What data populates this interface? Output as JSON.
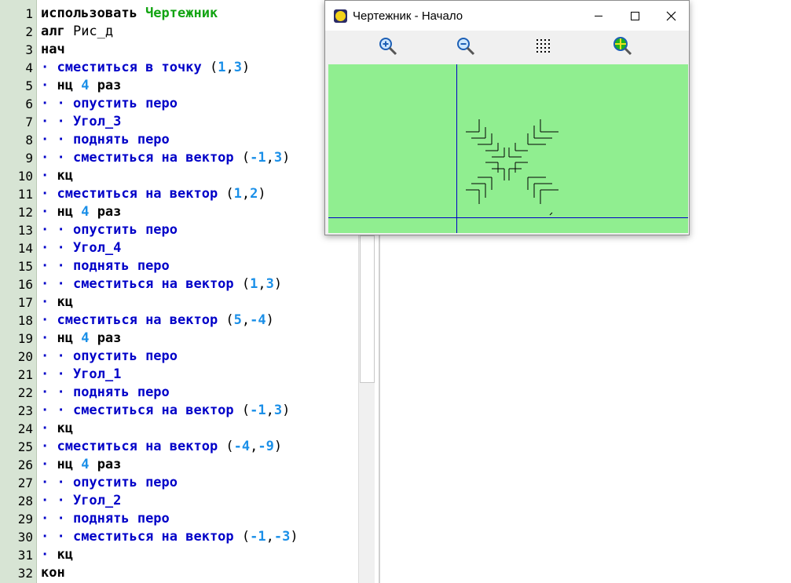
{
  "editor": {
    "lines": [
      {
        "n": "1",
        "parts": [
          {
            "t": "использовать ",
            "c": "kw"
          },
          {
            "t": "Чертежник",
            "c": "grn"
          }
        ]
      },
      {
        "n": "2",
        "parts": [
          {
            "t": "алг ",
            "c": "kw"
          },
          {
            "t": "Рис_д",
            "c": "plain"
          }
        ]
      },
      {
        "n": "3",
        "parts": [
          {
            "t": "нач",
            "c": "kw"
          }
        ]
      },
      {
        "n": "4",
        "parts": [
          {
            "t": "· ",
            "c": "dot"
          },
          {
            "t": "сместиться в точку ",
            "c": "fn"
          },
          {
            "t": "(",
            "c": "plain"
          },
          {
            "t": "1",
            "c": "num"
          },
          {
            "t": ",",
            "c": "plain"
          },
          {
            "t": "3",
            "c": "num"
          },
          {
            "t": ")",
            "c": "plain"
          }
        ]
      },
      {
        "n": "5",
        "parts": [
          {
            "t": "· ",
            "c": "dot"
          },
          {
            "t": "нц ",
            "c": "kw"
          },
          {
            "t": "4",
            "c": "num"
          },
          {
            "t": " раз",
            "c": "kw"
          }
        ]
      },
      {
        "n": "6",
        "parts": [
          {
            "t": "· · ",
            "c": "dot"
          },
          {
            "t": "опустить перо",
            "c": "fn"
          }
        ]
      },
      {
        "n": "7",
        "parts": [
          {
            "t": "· · ",
            "c": "dot"
          },
          {
            "t": "Угол_3",
            "c": "fn"
          }
        ]
      },
      {
        "n": "8",
        "parts": [
          {
            "t": "· · ",
            "c": "dot"
          },
          {
            "t": "поднять перо",
            "c": "fn"
          }
        ]
      },
      {
        "n": "9",
        "parts": [
          {
            "t": "· · ",
            "c": "dot"
          },
          {
            "t": "сместиться на вектор ",
            "c": "fn"
          },
          {
            "t": "(",
            "c": "plain"
          },
          {
            "t": "-1",
            "c": "num"
          },
          {
            "t": ",",
            "c": "plain"
          },
          {
            "t": "3",
            "c": "num"
          },
          {
            "t": ")",
            "c": "plain"
          }
        ]
      },
      {
        "n": "10",
        "parts": [
          {
            "t": "· ",
            "c": "dot"
          },
          {
            "t": "кц",
            "c": "kw"
          }
        ]
      },
      {
        "n": "11",
        "parts": [
          {
            "t": "· ",
            "c": "dot"
          },
          {
            "t": "сместиться на вектор ",
            "c": "fn"
          },
          {
            "t": "(",
            "c": "plain"
          },
          {
            "t": "1",
            "c": "num"
          },
          {
            "t": ",",
            "c": "plain"
          },
          {
            "t": "2",
            "c": "num"
          },
          {
            "t": ")",
            "c": "plain"
          }
        ]
      },
      {
        "n": "12",
        "parts": [
          {
            "t": "· ",
            "c": "dot"
          },
          {
            "t": "нц ",
            "c": "kw"
          },
          {
            "t": "4",
            "c": "num"
          },
          {
            "t": " раз",
            "c": "kw"
          }
        ]
      },
      {
        "n": "13",
        "parts": [
          {
            "t": "· · ",
            "c": "dot"
          },
          {
            "t": "опустить перо",
            "c": "fn"
          }
        ]
      },
      {
        "n": "14",
        "parts": [
          {
            "t": "· · ",
            "c": "dot"
          },
          {
            "t": "Угол_4",
            "c": "fn"
          }
        ]
      },
      {
        "n": "15",
        "parts": [
          {
            "t": "· · ",
            "c": "dot"
          },
          {
            "t": "поднять перо",
            "c": "fn"
          }
        ]
      },
      {
        "n": "16",
        "parts": [
          {
            "t": "· · ",
            "c": "dot"
          },
          {
            "t": "сместиться на вектор ",
            "c": "fn"
          },
          {
            "t": "(",
            "c": "plain"
          },
          {
            "t": "1",
            "c": "num"
          },
          {
            "t": ",",
            "c": "plain"
          },
          {
            "t": "3",
            "c": "num"
          },
          {
            "t": ")",
            "c": "plain"
          }
        ]
      },
      {
        "n": "17",
        "parts": [
          {
            "t": "· ",
            "c": "dot"
          },
          {
            "t": "кц",
            "c": "kw"
          }
        ]
      },
      {
        "n": "18",
        "parts": [
          {
            "t": "· ",
            "c": "dot"
          },
          {
            "t": "сместиться на вектор ",
            "c": "fn"
          },
          {
            "t": "(",
            "c": "plain"
          },
          {
            "t": "5",
            "c": "num"
          },
          {
            "t": ",",
            "c": "plain"
          },
          {
            "t": "-4",
            "c": "num"
          },
          {
            "t": ")",
            "c": "plain"
          }
        ]
      },
      {
        "n": "19",
        "parts": [
          {
            "t": "· ",
            "c": "dot"
          },
          {
            "t": "нц ",
            "c": "kw"
          },
          {
            "t": "4",
            "c": "num"
          },
          {
            "t": " раз",
            "c": "kw"
          }
        ]
      },
      {
        "n": "20",
        "parts": [
          {
            "t": "· · ",
            "c": "dot"
          },
          {
            "t": "опустить перо",
            "c": "fn"
          }
        ]
      },
      {
        "n": "21",
        "parts": [
          {
            "t": "· · ",
            "c": "dot"
          },
          {
            "t": "Угол_1",
            "c": "fn"
          }
        ]
      },
      {
        "n": "22",
        "parts": [
          {
            "t": "· · ",
            "c": "dot"
          },
          {
            "t": "поднять перо",
            "c": "fn"
          }
        ]
      },
      {
        "n": "23",
        "parts": [
          {
            "t": "· · ",
            "c": "dot"
          },
          {
            "t": "сместиться на вектор ",
            "c": "fn"
          },
          {
            "t": "(",
            "c": "plain"
          },
          {
            "t": "-1",
            "c": "num"
          },
          {
            "t": ",",
            "c": "plain"
          },
          {
            "t": "3",
            "c": "num"
          },
          {
            "t": ")",
            "c": "plain"
          }
        ]
      },
      {
        "n": "24",
        "parts": [
          {
            "t": "· ",
            "c": "dot"
          },
          {
            "t": "кц",
            "c": "kw"
          }
        ]
      },
      {
        "n": "25",
        "parts": [
          {
            "t": "· ",
            "c": "dot"
          },
          {
            "t": "сместиться на вектор ",
            "c": "fn"
          },
          {
            "t": "(",
            "c": "plain"
          },
          {
            "t": "-4",
            "c": "num"
          },
          {
            "t": ",",
            "c": "plain"
          },
          {
            "t": "-9",
            "c": "num"
          },
          {
            "t": ")",
            "c": "plain"
          }
        ]
      },
      {
        "n": "26",
        "parts": [
          {
            "t": "· ",
            "c": "dot"
          },
          {
            "t": "нц ",
            "c": "kw"
          },
          {
            "t": "4",
            "c": "num"
          },
          {
            "t": " раз",
            "c": "kw"
          }
        ]
      },
      {
        "n": "27",
        "parts": [
          {
            "t": "· · ",
            "c": "dot"
          },
          {
            "t": "опустить перо",
            "c": "fn"
          }
        ]
      },
      {
        "n": "28",
        "parts": [
          {
            "t": "· · ",
            "c": "dot"
          },
          {
            "t": "Угол_2",
            "c": "fn"
          }
        ]
      },
      {
        "n": "29",
        "parts": [
          {
            "t": "· · ",
            "c": "dot"
          },
          {
            "t": "поднять перо",
            "c": "fn"
          }
        ]
      },
      {
        "n": "30",
        "parts": [
          {
            "t": "· · ",
            "c": "dot"
          },
          {
            "t": "сместиться на вектор ",
            "c": "fn"
          },
          {
            "t": "(",
            "c": "plain"
          },
          {
            "t": "-1",
            "c": "num"
          },
          {
            "t": ",",
            "c": "plain"
          },
          {
            "t": "-3",
            "c": "num"
          },
          {
            "t": ")",
            "c": "plain"
          }
        ]
      },
      {
        "n": "31",
        "parts": [
          {
            "t": "· ",
            "c": "dot"
          },
          {
            "t": "кц",
            "c": "kw"
          }
        ]
      },
      {
        "n": "32",
        "parts": [
          {
            "t": "кон",
            "c": "kw"
          }
        ]
      }
    ]
  },
  "drawer_window": {
    "title": "Чертежник - Начало",
    "icons": [
      "app-smiley-icon",
      "minimize-icon",
      "maximize-icon",
      "close-icon"
    ],
    "toolbar": [
      "zoom-in-icon",
      "zoom-out-icon",
      "grid-icon",
      "fit-view-icon"
    ],
    "canvas_color": "#90ee90",
    "axis_color": "#0000c8"
  }
}
